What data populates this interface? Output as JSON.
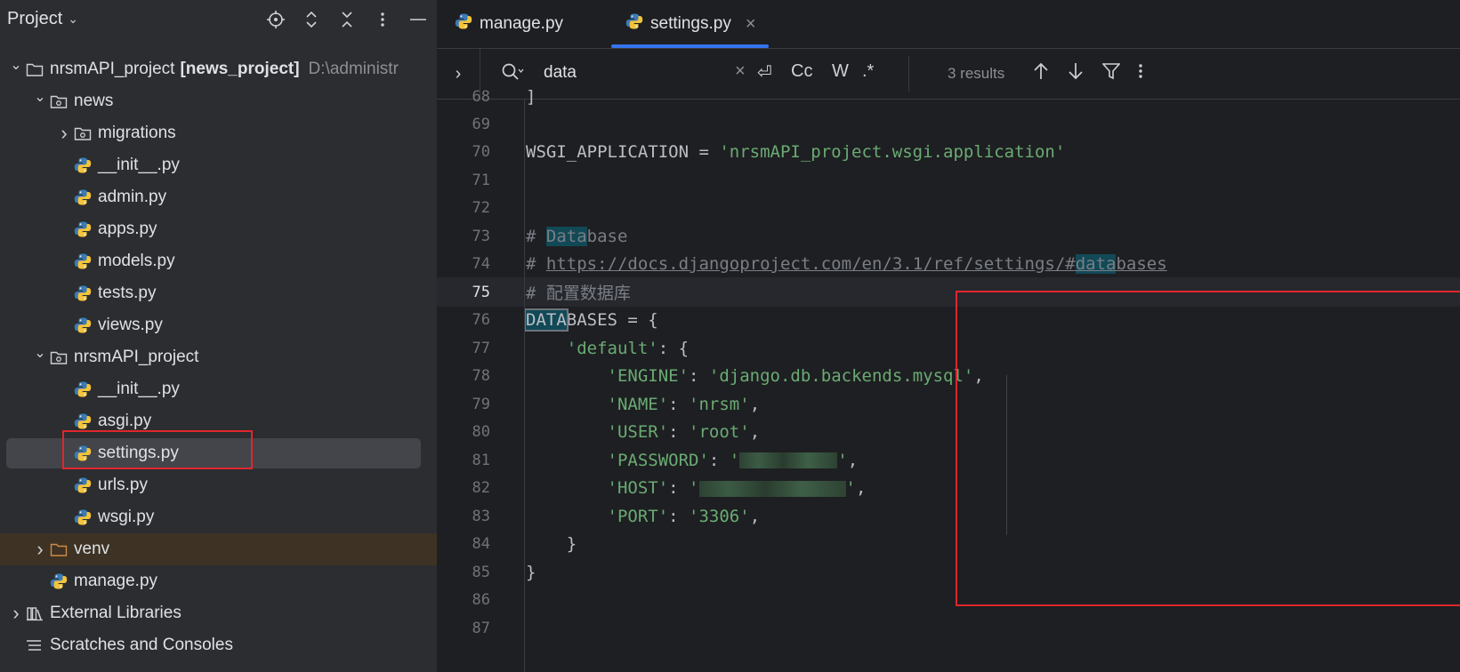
{
  "sidebar": {
    "title": "Project",
    "tools": [
      "locate-icon",
      "expand-icon",
      "collapse-icon",
      "more-icon",
      "minimize-icon"
    ],
    "tree": [
      {
        "indent": 0,
        "chev": "v",
        "icon": "folder",
        "label": "nrsmAPI_project",
        "bold": "[news_project]",
        "path": "D:\\administr"
      },
      {
        "indent": 1,
        "chev": "v",
        "icon": "pkg",
        "label": "news"
      },
      {
        "indent": 2,
        "chev": ">",
        "icon": "pkg",
        "label": "migrations"
      },
      {
        "indent": 2,
        "chev": "",
        "icon": "py",
        "label": "__init__.py"
      },
      {
        "indent": 2,
        "chev": "",
        "icon": "py",
        "label": "admin.py"
      },
      {
        "indent": 2,
        "chev": "",
        "icon": "py",
        "label": "apps.py"
      },
      {
        "indent": 2,
        "chev": "",
        "icon": "py",
        "label": "models.py"
      },
      {
        "indent": 2,
        "chev": "",
        "icon": "py",
        "label": "tests.py"
      },
      {
        "indent": 2,
        "chev": "",
        "icon": "py",
        "label": "views.py"
      },
      {
        "indent": 1,
        "chev": "v",
        "icon": "pkg",
        "label": "nrsmAPI_project"
      },
      {
        "indent": 2,
        "chev": "",
        "icon": "py",
        "label": "__init__.py"
      },
      {
        "indent": 2,
        "chev": "",
        "icon": "py",
        "label": "asgi.py"
      },
      {
        "indent": 2,
        "chev": "",
        "icon": "py",
        "label": "settings.py",
        "selected": true
      },
      {
        "indent": 2,
        "chev": "",
        "icon": "py",
        "label": "urls.py"
      },
      {
        "indent": 2,
        "chev": "",
        "icon": "py",
        "label": "wsgi.py"
      },
      {
        "indent": 1,
        "chev": ">",
        "icon": "folder-orange",
        "label": "venv",
        "venv": true
      },
      {
        "indent": 1,
        "chev": "",
        "icon": "py",
        "label": "manage.py"
      },
      {
        "indent": 0,
        "chev": ">",
        "icon": "lib",
        "label": "External Libraries"
      },
      {
        "indent": 0,
        "chev": "",
        "icon": "scratch",
        "label": "Scratches and Consoles"
      }
    ]
  },
  "tabs": [
    {
      "label": "manage.py",
      "active": false
    },
    {
      "label": "settings.py",
      "active": true,
      "close": "×"
    }
  ],
  "find": {
    "query": "data",
    "clear": "×",
    "options": [
      "⏎",
      "Cc",
      "W",
      ".*"
    ],
    "results": "3 results"
  },
  "code": {
    "first_line_partial": "68",
    "lines": [
      {
        "n": "69"
      },
      {
        "n": "70"
      },
      {
        "n": "71"
      },
      {
        "n": "72"
      },
      {
        "n": "73"
      },
      {
        "n": "74"
      },
      {
        "n": "75"
      },
      {
        "n": "76"
      },
      {
        "n": "77"
      },
      {
        "n": "78"
      },
      {
        "n": "79"
      },
      {
        "n": "80"
      },
      {
        "n": "81"
      },
      {
        "n": "82"
      },
      {
        "n": "83"
      },
      {
        "n": "84"
      },
      {
        "n": "85"
      },
      {
        "n": "86"
      },
      {
        "n": "87"
      }
    ],
    "text": {
      "l68": "]",
      "l70_a": "WSGI_APPLICATION = ",
      "l70_b": "'nrsmAPI_project.wsgi.application'",
      "l73_a": "# ",
      "l73_hl": "Data",
      "l73_b": "base",
      "l74_a": "# ",
      "l74_link_a": "https://docs.djangoproject.com/en/3.1/ref/settings/#",
      "l74_hl": "data",
      "l74_link_b": "bases",
      "l75": "# 配置数据库",
      "l76_hl": "DATA",
      "l76_b": "BASES = {",
      "l77_a": "    ",
      "l77_key": "'default'",
      "l77_b": ": {",
      "l78_key": "'ENGINE'",
      "l78_val": "'django.db.backends.mysql'",
      "l79_key": "'NAME'",
      "l79_val": "'nrsm'",
      "l80_key": "'USER'",
      "l80_val": "'root'",
      "l81_key": "'PASSWORD'",
      "l81_q": "'",
      "l82_key": "'HOST'",
      "l82_q": "'",
      "l83_key": "'PORT'",
      "l83_val": "'3306'",
      "l84": "    }",
      "l85": "}",
      "colon": ": ",
      "comma": ","
    }
  },
  "colors": {
    "accent": "#3574f0",
    "highlight": "#e0262e",
    "string": "#6aab73",
    "comment": "#7a7e85"
  }
}
